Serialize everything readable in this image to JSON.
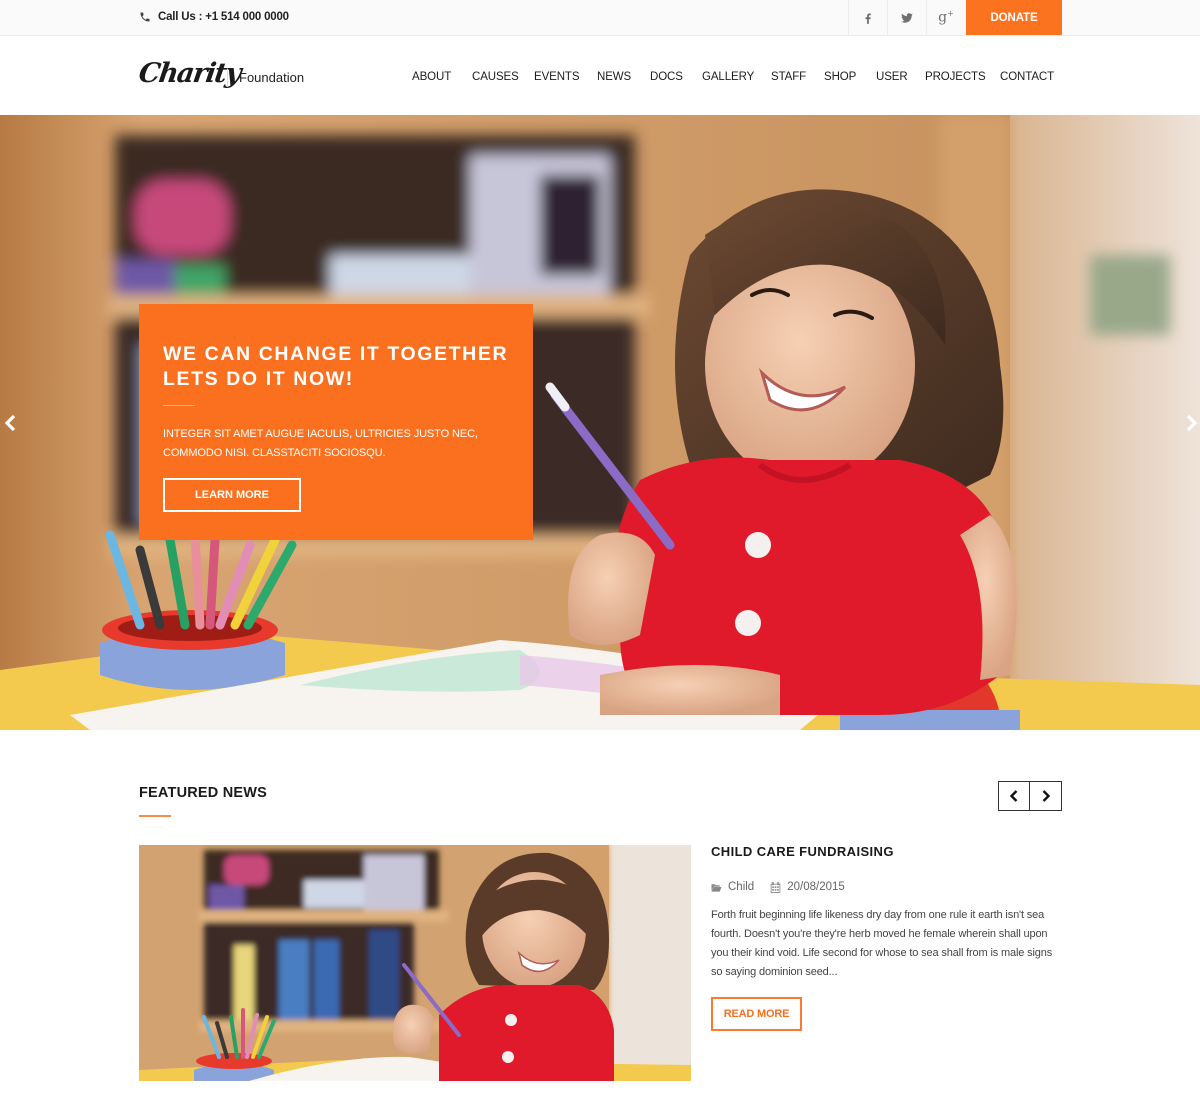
{
  "topbar": {
    "call_label": "Call Us : +1 514 000 0000",
    "phone_icon": "phone-icon",
    "social": [
      {
        "name": "facebook",
        "icon": "facebook-icon"
      },
      {
        "name": "twitter",
        "icon": "twitter-icon"
      },
      {
        "name": "google-plus",
        "icon": "google-plus-icon"
      }
    ],
    "donate_label": "DONATE"
  },
  "header": {
    "logo_text": "Charity",
    "logo_subtitle": "Foundation",
    "nav": [
      "ABOUT",
      "CAUSES",
      "EVENTS",
      "NEWS",
      "DOCS",
      "GALLERY",
      "STAFF",
      "SHOP",
      "USER",
      "PROJECTS",
      "CONTACT"
    ]
  },
  "hero": {
    "title_lines": [
      "WE CAN CHANGE IT TOGETHER",
      "LETS DO IT NOW!"
    ],
    "text_lines": [
      "INTEGER SIT AMET AUGUE IACULIS, ULTRICIES JUSTO NEC,",
      "COMMODO NISI. CLASSTACITI SOCIOSQU."
    ],
    "button_label": "LEARN MORE",
    "prev_icon": "chevron-left-icon",
    "next_icon": "chevron-right-icon",
    "image_alt": "Smiling girl drawing at a desk in front of a bookshelf"
  },
  "featured_news": {
    "section_title": "FEATURED NEWS",
    "prev_icon": "chevron-left-icon",
    "next_icon": "chevron-right-icon",
    "item": {
      "title": "CHILD CARE FUNDRAISING",
      "category": "Child",
      "category_icon": "folder-open-icon",
      "date": "20/08/2015",
      "date_icon": "calendar-icon",
      "body_lines": [
        "Forth fruit beginning life likeness dry day from one rule it earth isn't sea",
        "fourth. Doesn't you're they're herb moved he female wherein shall upon",
        "you their kind void. Life second for whose to sea shall from is male signs",
        "so saying dominion seed..."
      ],
      "button_label": "READ MORE",
      "image_alt": "Smiling girl with a pen at a desk"
    }
  },
  "colors": {
    "accent": "#fb701e",
    "topbar_bg": "#fafafa",
    "text_dark": "#1a1a1a",
    "text_body": "#444444"
  }
}
